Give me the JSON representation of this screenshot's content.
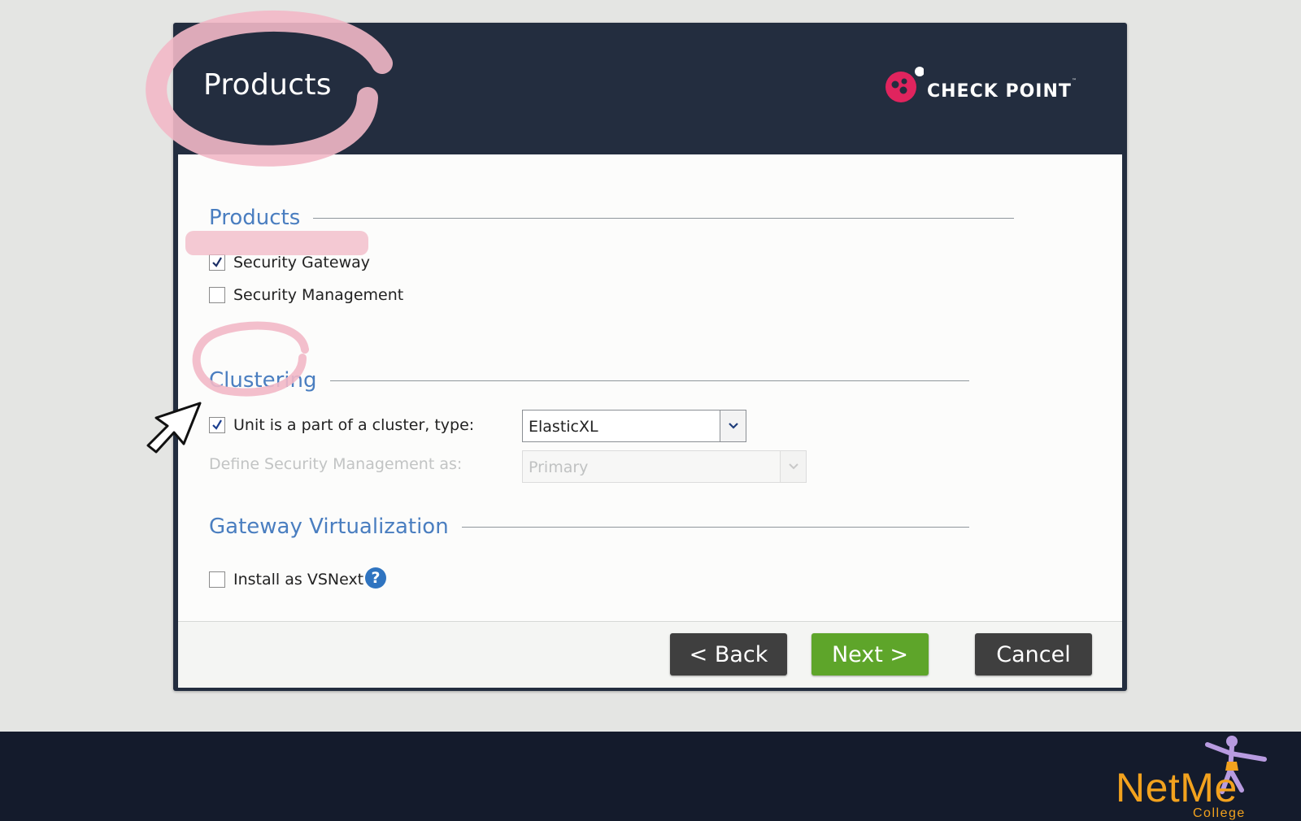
{
  "dialog": {
    "title": "Products",
    "brand": {
      "name": "CHECK POINT",
      "tm": "™",
      "logo_icon": "check-point-logo"
    }
  },
  "sections": {
    "products": {
      "title": "Products",
      "items": [
        {
          "label": "Security Gateway",
          "checked": true
        },
        {
          "label": "Security Management",
          "checked": false
        }
      ]
    },
    "clustering": {
      "title": "Clustering",
      "cluster_checkbox": {
        "label": "Unit is a part of a cluster, type:",
        "checked": true
      },
      "cluster_type": {
        "value": "ElasticXL"
      },
      "define_mgmt": {
        "label": "Define Security Management as:",
        "value": "Primary",
        "disabled": true
      }
    },
    "virtualization": {
      "title": "Gateway Virtualization",
      "vsnext": {
        "label": "Install as VSNext",
        "checked": false,
        "help_icon": "question-mark-icon",
        "help_glyph": "?"
      }
    }
  },
  "buttons": {
    "back": "< Back",
    "next": "Next >",
    "cancel": "Cancel"
  },
  "watermark": {
    "name": "NetMe",
    "sub": "College"
  },
  "colors": {
    "header_bg": "#232d3f",
    "section_title": "#4a7ec0",
    "next_button": "#5ea52a",
    "dark_button": "#3f3f3f",
    "annotation": "#f2b8c6",
    "brand_accent": "#e0245e",
    "watermark": "#f2a21e"
  }
}
